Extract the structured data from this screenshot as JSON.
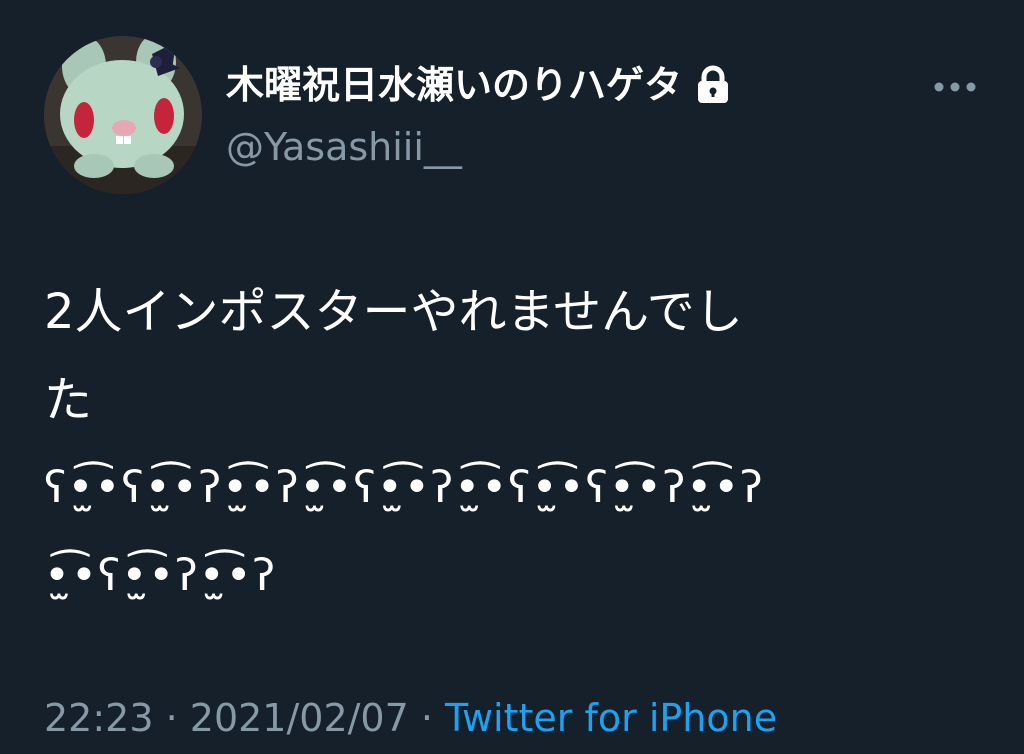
{
  "author": {
    "display_name": "木曜祝日水瀬いのりハゲタ",
    "handle": "@Yasashiii__",
    "protected_icon": "lock-icon",
    "avatar_icon": "plush-avatar"
  },
  "more_icon": "more-horizontal-icon",
  "tweet": {
    "lines": [
      "2人インポスターやれませんでし",
      "た",
      "ʕ•̫͡•ʕ•̫͡•ʔ•̫͡•ʔ•̫͡•ʕ•̫͡•ʔ•̫͡•ʕ•̫͡•ʕ•̫͡•ʔ•̫͡•ʔ",
      "•̫͡•ʕ•̫͡•ʔ•̫͡•ʔ"
    ]
  },
  "meta": {
    "time": "22:23",
    "separator_1": " · ",
    "date": "2021/02/07",
    "separator_2": " · ",
    "source": "Twitter for iPhone"
  },
  "colors": {
    "background": "#15202b",
    "text": "#ffffff",
    "secondary": "#8899a6",
    "link": "#1da1f2"
  }
}
